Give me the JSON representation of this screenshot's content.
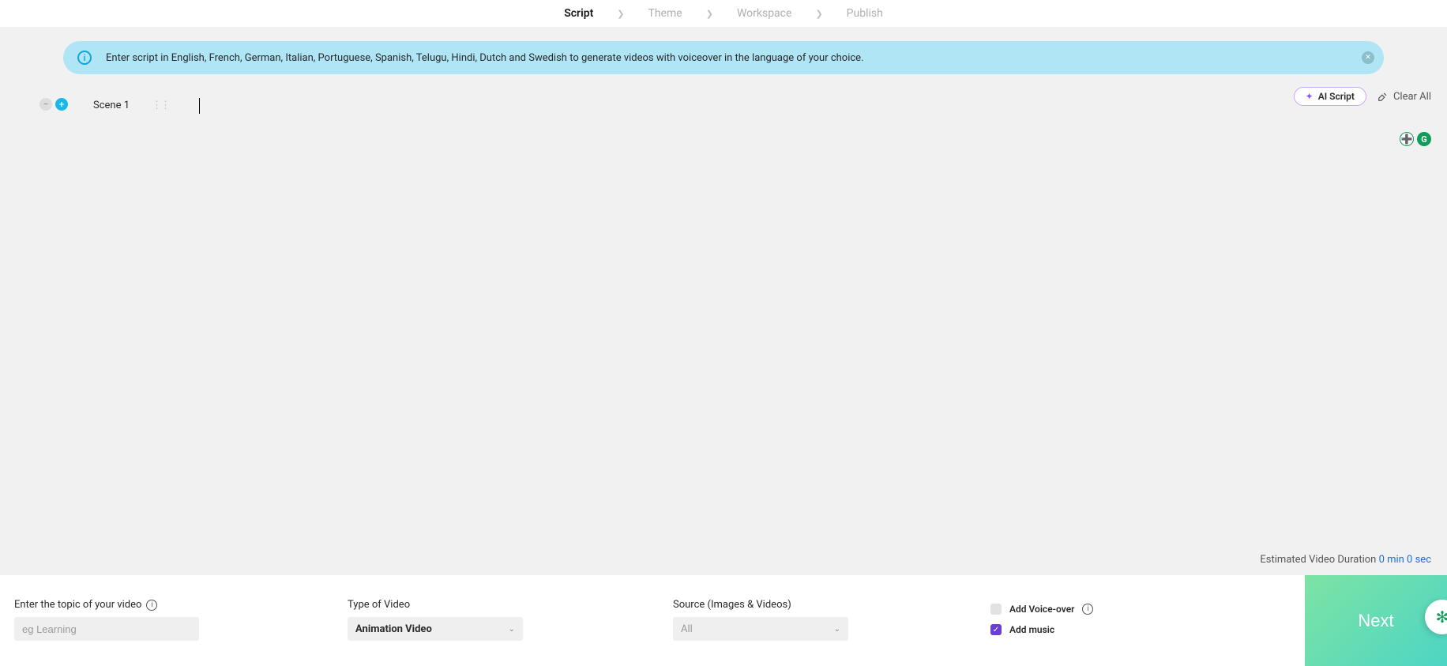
{
  "steps": {
    "script": "Script",
    "theme": "Theme",
    "workspace": "Workspace",
    "publish": "Publish"
  },
  "banner": {
    "text": "Enter script in English, French, German, Italian, Portuguese, Spanish, Telugu, Hindi, Dutch and Swedish to generate videos with voiceover in the language of your choice."
  },
  "actions": {
    "ai_script": "AI Script",
    "clear_all": "Clear All"
  },
  "scene": {
    "label": "Scene 1"
  },
  "duration": {
    "label": "Estimated Video Duration ",
    "value": "0 min 0 sec"
  },
  "fields": {
    "topic_label": "Enter the topic of your video",
    "topic_placeholder": "eg Learning",
    "type_label": "Type of Video",
    "type_value": "Animation Video",
    "source_label": "Source (Images & Videos)",
    "source_value": "All"
  },
  "checks": {
    "voice": "Add Voice-over",
    "music": "Add music"
  },
  "next": "Next",
  "badges": {
    "g": "G"
  }
}
